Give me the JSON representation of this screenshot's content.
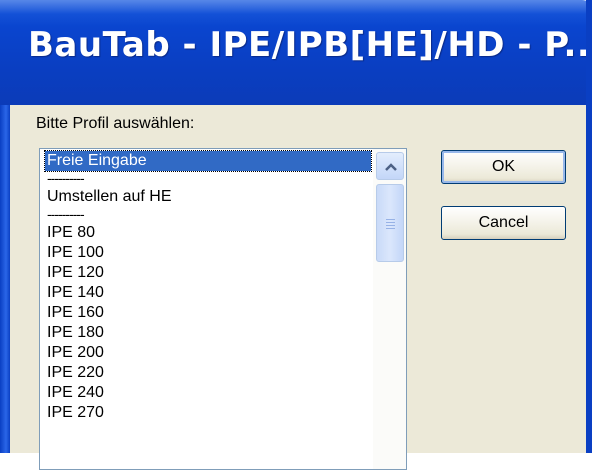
{
  "window": {
    "title": "BauTab - IPE/IPB[HE]/HD - P..."
  },
  "prompt": "Bitte Profil auswählen:",
  "list": {
    "items": [
      {
        "label": "Freie Eingabe",
        "selected": true
      },
      {
        "label": "----------"
      },
      {
        "label": "Umstellen auf HE"
      },
      {
        "label": "----------"
      },
      {
        "label": "IPE 80"
      },
      {
        "label": "IPE 100"
      },
      {
        "label": "IPE 120"
      },
      {
        "label": "IPE 140"
      },
      {
        "label": "IPE 160"
      },
      {
        "label": "IPE 180"
      },
      {
        "label": "IPE 200"
      },
      {
        "label": "IPE 220"
      },
      {
        "label": "IPE 240"
      },
      {
        "label": "IPE 270"
      }
    ]
  },
  "buttons": {
    "ok": "OK",
    "cancel": "Cancel"
  },
  "colors": {
    "titlebar": "#0a45cf",
    "selection": "#316ac5",
    "dialog_bg": "#ece9d8"
  },
  "icons": {
    "scroll_up": "chevron-up-icon",
    "thumb_grip": "scroll-grip-icon"
  }
}
